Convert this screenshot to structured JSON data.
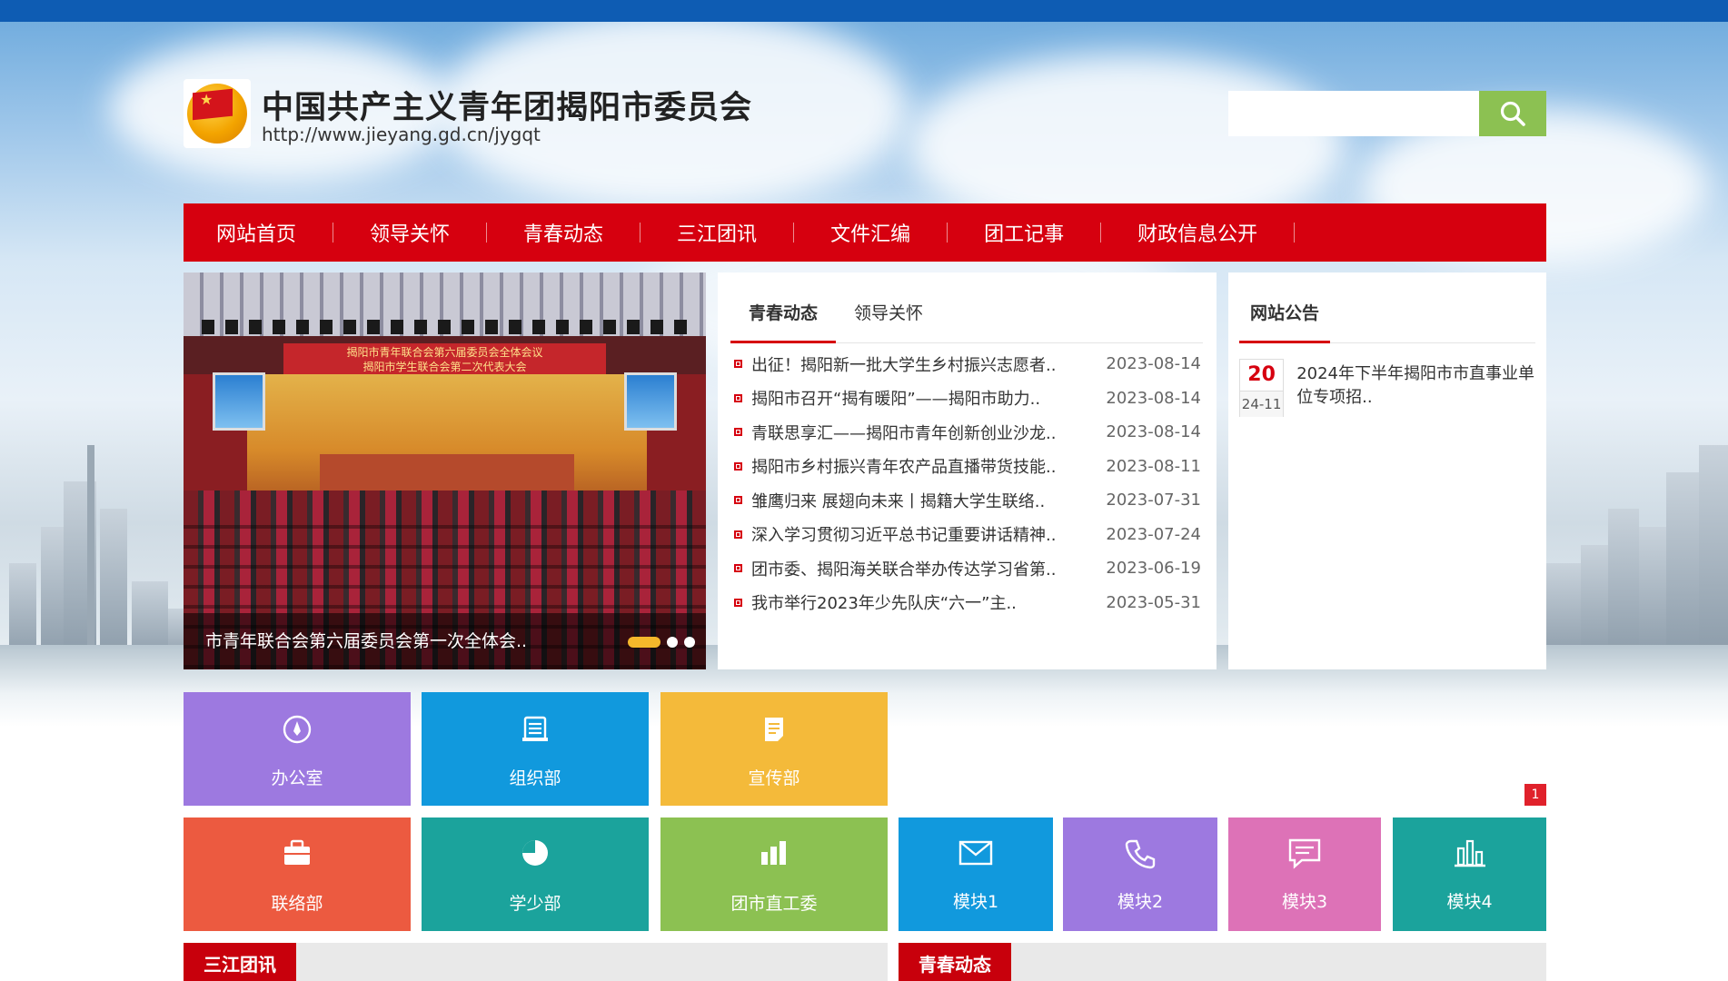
{
  "site": {
    "title": "中国共产主义青年团揭阳市委员会",
    "url": "http://www.jieyang.gd.cn/jygqt",
    "logo_text": "共青团"
  },
  "search": {
    "placeholder": "",
    "value": ""
  },
  "nav": [
    {
      "label": "网站首页"
    },
    {
      "label": "领导关怀"
    },
    {
      "label": "青春动态"
    },
    {
      "label": "三江团讯"
    },
    {
      "label": "文件汇编"
    },
    {
      "label": "团工记事"
    },
    {
      "label": "财政信息公开"
    }
  ],
  "slider": {
    "caption": "市青年联合会第六届委员会第一次全体会..",
    "banner_line1": "揭阳市青年联合会第六届委员会全体会议",
    "banner_line2": "揭阳市学生联合会第二次代表大会",
    "active_slide": 1,
    "total_slides": 3
  },
  "news": {
    "tabs": [
      {
        "label": "青春动态",
        "active": true
      },
      {
        "label": "领导关怀",
        "active": false
      }
    ],
    "items": [
      {
        "title": "出征！揭阳新一批大学生乡村振兴志愿者..",
        "date": "2023-08-14"
      },
      {
        "title": "揭阳市召开“揭有暖阳”——揭阳市助力..",
        "date": "2023-08-14"
      },
      {
        "title": "青联思享汇——揭阳市青年创新创业沙龙..",
        "date": "2023-08-14"
      },
      {
        "title": "揭阳市乡村振兴青年农产品直播带货技能..",
        "date": "2023-08-11"
      },
      {
        "title": "雏鹰归来 展翅向未来丨揭籍大学生联络..",
        "date": "2023-07-31"
      },
      {
        "title": "深入学习贯彻习近平总书记重要讲话精神..",
        "date": "2023-07-24"
      },
      {
        "title": "团市委、揭阳海关联合举办传达学习省第..",
        "date": "2023-06-19"
      },
      {
        "title": "我市举行2023年少先队庆“六一”主..",
        "date": "2023-05-31"
      }
    ]
  },
  "notice": {
    "title": "网站公告",
    "items": [
      {
        "day": "20",
        "ym": "24-11",
        "text": "2024年下半年揭阳市市直事业单位专项招.."
      }
    ]
  },
  "tiles": [
    {
      "label": "办公室",
      "icon": "compass-icon",
      "color": "#9d79e0"
    },
    {
      "label": "组织部",
      "icon": "document-stack-icon",
      "color": "#1199dd"
    },
    {
      "label": "宣传部",
      "icon": "note-icon",
      "color": "#f4ba3a"
    },
    {
      "label": "联络部",
      "icon": "briefcase-icon",
      "color": "#ec5a40"
    },
    {
      "label": "学少部",
      "icon": "pie-chart-icon",
      "color": "#1ba39c"
    },
    {
      "label": "团市直工委",
      "icon": "bar-chart-icon",
      "color": "#8cc152"
    },
    {
      "label": "模块1",
      "icon": "mail-icon",
      "color": "#1199dd"
    },
    {
      "label": "模块2",
      "icon": "phone-icon",
      "color": "#9d79e0"
    },
    {
      "label": "模块3",
      "icon": "chat-icon",
      "color": "#dd72b7"
    },
    {
      "label": "模块4",
      "icon": "column-chart-icon",
      "color": "#1ba39c"
    }
  ],
  "badge_count": "1",
  "sections": [
    {
      "title": "三江团讯"
    },
    {
      "title": "青春动态"
    }
  ],
  "colors": {
    "topbar": "#0e5cb3",
    "nav": "#d6000f",
    "search_button": "#8cc152"
  }
}
